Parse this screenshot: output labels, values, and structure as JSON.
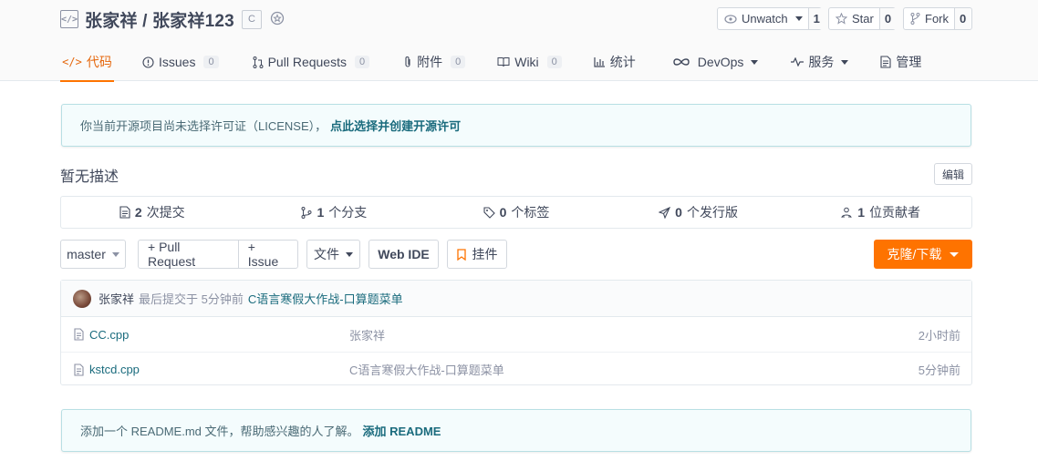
{
  "repo": {
    "title": "张家祥 / 张家祥123",
    "language_badge": "C",
    "watch": {
      "label": "Unwatch",
      "count": "1"
    },
    "star": {
      "label": "Star",
      "count": "0"
    },
    "fork": {
      "label": "Fork",
      "count": "0"
    }
  },
  "nav": {
    "code": "代码",
    "issues": {
      "label": "Issues",
      "count": "0"
    },
    "pull_requests": {
      "label": "Pull Requests",
      "count": "0"
    },
    "attachments": {
      "label": "附件",
      "count": "0"
    },
    "wiki": {
      "label": "Wiki",
      "count": "0"
    },
    "stats": "统计",
    "devops": "DevOps",
    "services": "服务",
    "manage": "管理"
  },
  "license_notice": {
    "text": "你当前开源项目尚未选择许可证（LICENSE），",
    "link": "点此选择并创建开源许可"
  },
  "description": {
    "text": "暂无描述",
    "edit_label": "编辑"
  },
  "stats": {
    "commits": {
      "count": "2",
      "label": "次提交"
    },
    "branches": {
      "count": "1",
      "label": "个分支"
    },
    "tags": {
      "count": "0",
      "label": "个标签"
    },
    "releases": {
      "count": "0",
      "label": "个发行版"
    },
    "contributors": {
      "count": "1",
      "label": "位贡献者"
    }
  },
  "toolbar": {
    "branch": "master",
    "pull_request": "+ Pull Request",
    "issue": "+ Issue",
    "file": "文件",
    "web_ide": "Web IDE",
    "widget": "挂件",
    "clone": "克隆/下载"
  },
  "latest_commit": {
    "author": "张家祥",
    "meta": "最后提交于 5分钟前",
    "message": "C语言寒假大作战-口算题菜单"
  },
  "files": [
    {
      "name": "CC.cpp",
      "commit": "张家祥",
      "time": "2小时前"
    },
    {
      "name": "kstcd.cpp",
      "commit": "C语言寒假大作战-口算题菜单",
      "time": "5分钟前"
    }
  ],
  "readme_notice": {
    "text": "添加一个 README.md 文件，帮助感兴趣的人了解。",
    "link": "添加 README"
  },
  "colors": {
    "accent": "#fe7300",
    "link": "#1a6b7d",
    "notice_bg": "#f4fcfd",
    "notice_border": "#b8dfe4"
  }
}
